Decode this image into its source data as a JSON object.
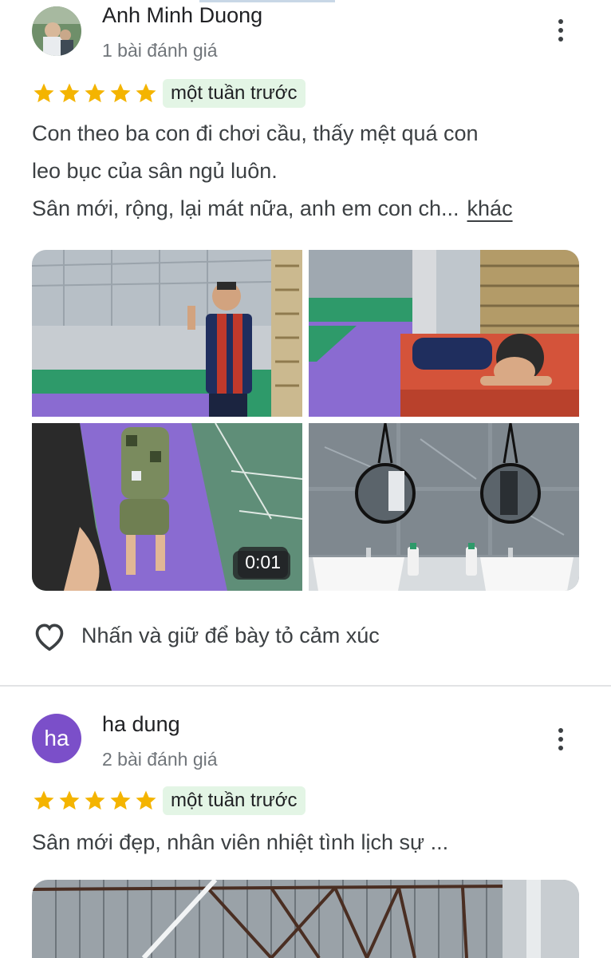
{
  "reviews": [
    {
      "author": "Anh Minh Duong",
      "review_count": "1 bài đánh giá",
      "rating": 5,
      "time_ago": "một tuần trước",
      "text_lines": [
        "Con theo ba con đi chơi cầu, thấy mệt quá con",
        "leo bục của sân ngủ luôn.",
        "Sân mới, rộng, lại mát nữa,  anh em con ch..."
      ],
      "more_label": "khác",
      "video_duration": "0:01",
      "reaction_label": "Nhấn và giữ để bày tỏ cảm xúc"
    },
    {
      "author": "ha dung",
      "avatar_initials": "ha",
      "avatar_color": "#7b4fc9",
      "review_count": "2 bài đánh giá",
      "rating": 5,
      "time_ago": "một tuần trước",
      "text_lines": [
        "Sân mới đẹp, nhân viên nhiệt tình lịch sự ..."
      ]
    }
  ],
  "icons": {
    "star": "star-icon",
    "more": "more-vert-icon",
    "heart": "heart-outline-icon"
  },
  "colors": {
    "star": "#f4b400",
    "badge_bg": "#e3f5e5",
    "court_green": "#2e9a6a",
    "court_purple": "#8a6bd1"
  }
}
